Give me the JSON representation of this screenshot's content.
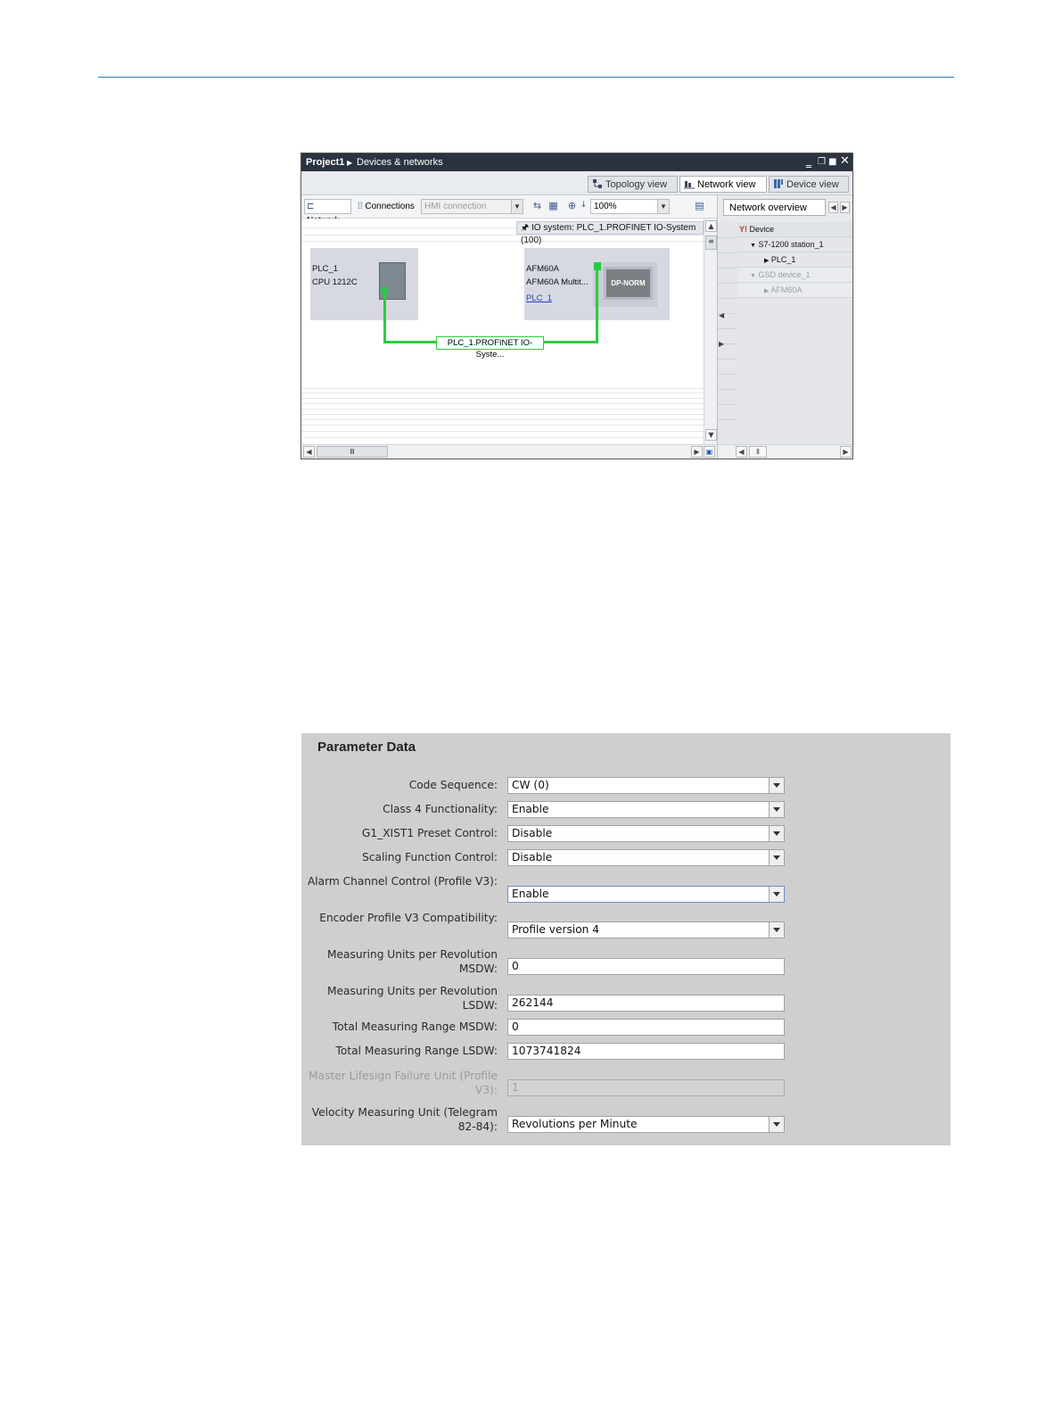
{
  "network_window": {
    "breadcrumb": [
      "Project1",
      "Devices & networks"
    ],
    "view_tabs": [
      {
        "label": "Topology view",
        "active": false
      },
      {
        "label": "Network view",
        "active": true
      },
      {
        "label": "Device view",
        "active": false
      }
    ],
    "toolbar": {
      "network_label": "Network",
      "connections_label": "Connections",
      "connection_type": "HMI connection",
      "zoom": "100%"
    },
    "io_system_label": "IO system: PLC_1.PROFINET IO-System (100)",
    "devices": {
      "plc": {
        "name": "PLC_1",
        "type": "CPU 1212C"
      },
      "encoder": {
        "name": "AFM60A",
        "type": "AFM60A Multit...",
        "link": "PLC_1",
        "module": "DP-NORM"
      }
    },
    "network_label": "PLC_1.PROFINET IO-Syste...",
    "overview": {
      "tab_label": "Network overview",
      "column_header": "Device",
      "rows": [
        {
          "label": "S7-1200 station_1",
          "indent": 1,
          "gray": false
        },
        {
          "label": "PLC_1",
          "indent": 2,
          "gray": false
        },
        {
          "label": "GSD device_1",
          "indent": 1,
          "gray": true
        },
        {
          "label": "AFM60A",
          "indent": 2,
          "gray": true
        }
      ]
    },
    "colors": {
      "titlebar": "#2b3340",
      "network_green": "#2ecc40",
      "device_box": "#d6d8e2"
    }
  },
  "parameter_data": {
    "title": "Parameter Data",
    "fields": [
      {
        "label": "Code Sequence:",
        "value": "CW (0)",
        "type": "dropdown"
      },
      {
        "label": "Class 4 Functionality:",
        "value": "Enable",
        "type": "dropdown"
      },
      {
        "label": "G1_XIST1 Preset Control:",
        "value": "Disable",
        "type": "dropdown"
      },
      {
        "label": "Scaling Function Control:",
        "value": "Disable",
        "type": "dropdown"
      },
      {
        "label": "Alarm Channel Control (Profile V3):",
        "value": "Enable",
        "type": "dropdown"
      },
      {
        "label": "Encoder Profile V3 Compatibility:",
        "value": "Profile version 4",
        "type": "dropdown"
      },
      {
        "label": "Measuring Units per Revolution MSDW:",
        "value": "0",
        "type": "text"
      },
      {
        "label": "Measuring Units per Revolution LSDW:",
        "value": "262144",
        "type": "text"
      },
      {
        "label": "Total Measuring Range MSDW:",
        "value": "0",
        "type": "text"
      },
      {
        "label": "Total Measuring Range LSDW:",
        "value": "1073741824",
        "type": "text"
      },
      {
        "label": "Master Lifesign Failure Unit (Profile V3):",
        "value": "1",
        "type": "disabled"
      },
      {
        "label": "Velocity Measuring Unit (Telegram 82-84):",
        "value": "Revolutions per Minute",
        "type": "dropdown"
      }
    ]
  }
}
